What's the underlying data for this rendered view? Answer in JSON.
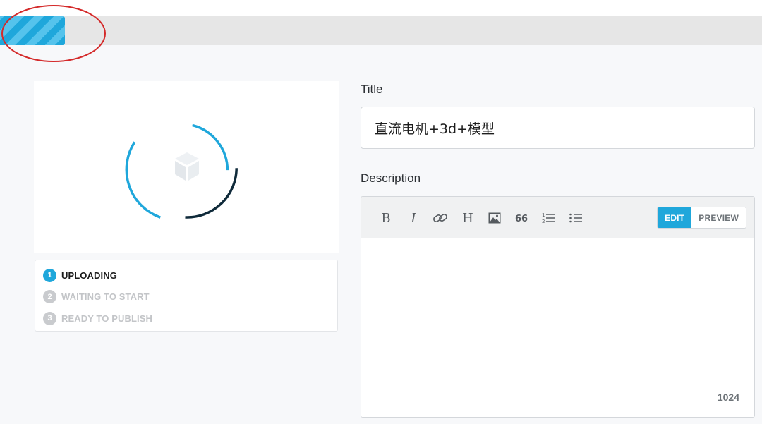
{
  "upload": {
    "progress_percent": 8.5
  },
  "preview": {
    "icon": "cube-icon",
    "spinner": "loading-spinner"
  },
  "steps": [
    {
      "number": "1",
      "label": "UPLOADING",
      "state": "active"
    },
    {
      "number": "2",
      "label": "WAITING TO START",
      "state": "inactive"
    },
    {
      "number": "3",
      "label": "READY TO PUBLISH",
      "state": "inactive"
    }
  ],
  "form": {
    "title_label": "Title",
    "title_value": "直流电机+3d+模型",
    "description_label": "Description"
  },
  "editor": {
    "toolbar": [
      {
        "name": "bold-icon",
        "label": "Bold"
      },
      {
        "name": "italic-icon",
        "label": "Italic"
      },
      {
        "name": "link-icon",
        "label": "Link"
      },
      {
        "name": "heading-icon",
        "label": "Heading"
      },
      {
        "name": "image-icon",
        "label": "Image"
      },
      {
        "name": "quote-icon",
        "label": "Quote"
      },
      {
        "name": "ordered-list-icon",
        "label": "Ordered list"
      },
      {
        "name": "unordered-list-icon",
        "label": "Unordered list"
      }
    ],
    "edit_label": "EDIT",
    "preview_label": "PREVIEW",
    "char_count": "1024",
    "description_value": ""
  },
  "colors": {
    "accent": "#1fa7db",
    "annotation": "#d42a2a",
    "spinner_dark": "#0f2a3a"
  }
}
